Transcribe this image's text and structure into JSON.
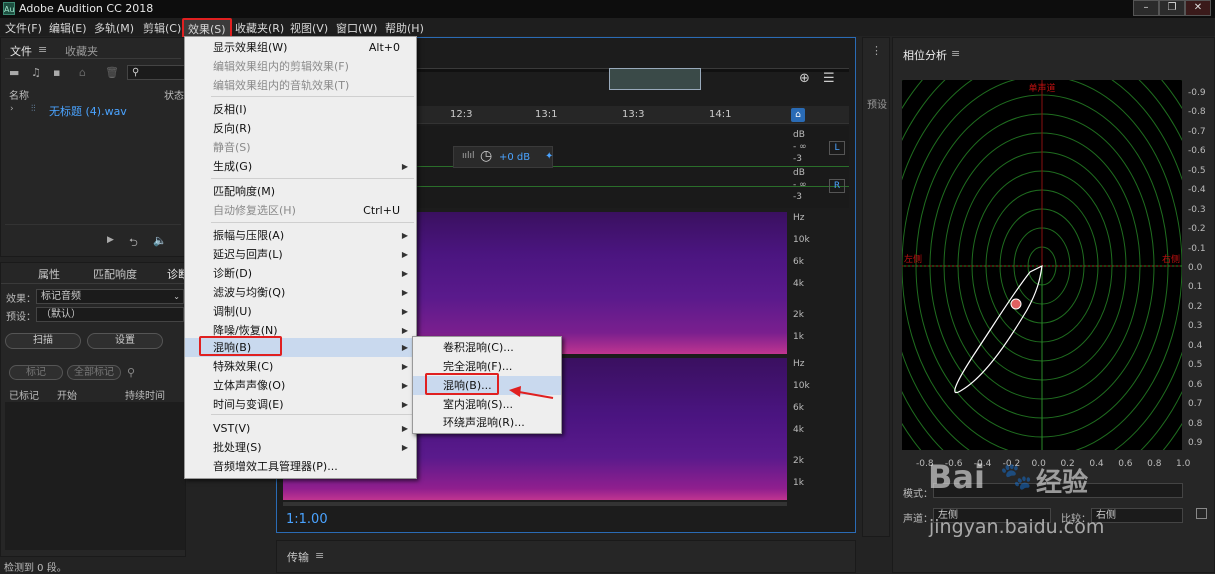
{
  "window": {
    "title": "Adobe Audition CC 2018",
    "logo": "Au"
  },
  "menubar": {
    "items": [
      "文件(F)",
      "编辑(E)",
      "多轨(M)",
      "剪辑(C)",
      "效果(S)",
      "收藏夹(R)",
      "视图(V)",
      "窗口(W)",
      "帮助(H)"
    ]
  },
  "files_panel": {
    "tab_files": "文件",
    "tab_favorites": "收藏夹",
    "col_name": "名称",
    "col_status": "状态",
    "file_name": "无标题 (4).wav"
  },
  "effects_panel": {
    "tab_properties": "属性",
    "tab_match_loudness": "匹配响度",
    "tab_diagnostics": "诊断",
    "effect_label": "效果：",
    "effect_value": "标记音频",
    "preset_label": "预设：",
    "preset_value": "（默认）",
    "scan_button": "扫描",
    "settings_button": "设置",
    "mark_button": "标记",
    "mark_all_button": "全部标记",
    "col_marked": "已标记",
    "col_start": "开始",
    "col_duration": "持续时间",
    "status": "检测到 0 段。"
  },
  "editor": {
    "timecode": "1:1.00",
    "times": [
      "12:3",
      "13:1",
      "13:3",
      "14:1"
    ],
    "gain": "+0 dB",
    "db_labels": [
      "dB",
      "- ∞",
      "-3",
      "dB",
      "- ∞",
      "-3"
    ],
    "channel_L": "L",
    "channel_R": "R",
    "hz_top": [
      "Hz",
      "10k",
      "6k",
      "4k",
      "2k",
      "1k"
    ],
    "hz_bottom": [
      "Hz",
      "10k",
      "6k",
      "4k",
      "2k",
      "1k"
    ]
  },
  "transport_panel": {
    "title": "传输"
  },
  "effects_menu": {
    "items": [
      {
        "label": "显示效果组(W)",
        "shortcut": "Alt+0",
        "disabled": false,
        "submenu": false
      },
      {
        "label": "编辑效果组内的剪辑效果(F)",
        "shortcut": "",
        "disabled": true,
        "submenu": false
      },
      {
        "label": "编辑效果组内的音轨效果(T)",
        "shortcut": "",
        "disabled": true,
        "submenu": false
      },
      {
        "label": "反相(I)",
        "shortcut": "",
        "disabled": false,
        "submenu": false
      },
      {
        "label": "反向(R)",
        "shortcut": "",
        "disabled": false,
        "submenu": false
      },
      {
        "label": "静音(S)",
        "shortcut": "",
        "disabled": true,
        "submenu": false
      },
      {
        "label": "生成(G)",
        "shortcut": "",
        "disabled": false,
        "submenu": true
      },
      {
        "label": "匹配响度(M)",
        "shortcut": "",
        "disabled": false,
        "submenu": false
      },
      {
        "label": "自动修复选区(H)",
        "shortcut": "Ctrl+U",
        "disabled": true,
        "submenu": false
      },
      {
        "label": "振幅与压限(A)",
        "shortcut": "",
        "disabled": false,
        "submenu": true
      },
      {
        "label": "延迟与回声(L)",
        "shortcut": "",
        "disabled": false,
        "submenu": true
      },
      {
        "label": "诊断(D)",
        "shortcut": "",
        "disabled": false,
        "submenu": true
      },
      {
        "label": "滤波与均衡(Q)",
        "shortcut": "",
        "disabled": false,
        "submenu": true
      },
      {
        "label": "调制(U)",
        "shortcut": "",
        "disabled": false,
        "submenu": true
      },
      {
        "label": "降噪/恢复(N)",
        "shortcut": "",
        "disabled": false,
        "submenu": true
      },
      {
        "label": "混响(B)",
        "shortcut": "",
        "disabled": false,
        "submenu": true
      },
      {
        "label": "特殊效果(C)",
        "shortcut": "",
        "disabled": false,
        "submenu": true
      },
      {
        "label": "立体声声像(O)",
        "shortcut": "",
        "disabled": false,
        "submenu": true
      },
      {
        "label": "时间与变调(E)",
        "shortcut": "",
        "disabled": false,
        "submenu": true
      },
      {
        "label": "VST(V)",
        "shortcut": "",
        "disabled": false,
        "submenu": true
      },
      {
        "label": "批处理(S)",
        "shortcut": "",
        "disabled": false,
        "submenu": true
      },
      {
        "label": "音频增效工具管理器(P)...",
        "shortcut": "",
        "disabled": false,
        "submenu": false
      }
    ]
  },
  "reverb_submenu": {
    "items": [
      "卷积混响(C)...",
      "完全混响(F)...",
      "混响(B)...",
      "室内混响(S)...",
      "环绕声混响(R)..."
    ]
  },
  "phase_panel": {
    "title": "相位分析",
    "preset_tab": "预设",
    "top_label": "单声道",
    "left_label": "左侧",
    "right_label": "右侧",
    "y_ticks": [
      "-0.9",
      "-0.8",
      "-0.7",
      "-0.6",
      "-0.5",
      "-0.4",
      "-0.3",
      "-0.2",
      "-0.1",
      "0.0",
      "0.1",
      "0.2",
      "0.3",
      "0.4",
      "0.5",
      "0.6",
      "0.7",
      "0.8",
      "0.9"
    ],
    "x_ticks": [
      "-0.8",
      "-0.6",
      "-0.4",
      "-0.2",
      "0.0",
      "0.2",
      "0.4",
      "0.6",
      "0.8",
      "1.0"
    ],
    "mode_label": "模式：",
    "channel_label": "声道：",
    "channel_value": "左侧",
    "compare_label": "比较：",
    "compare_value": "右侧"
  },
  "watermark": {
    "brand": "Bai",
    "brand2": "经验",
    "url": "jingyan.baidu.com"
  }
}
